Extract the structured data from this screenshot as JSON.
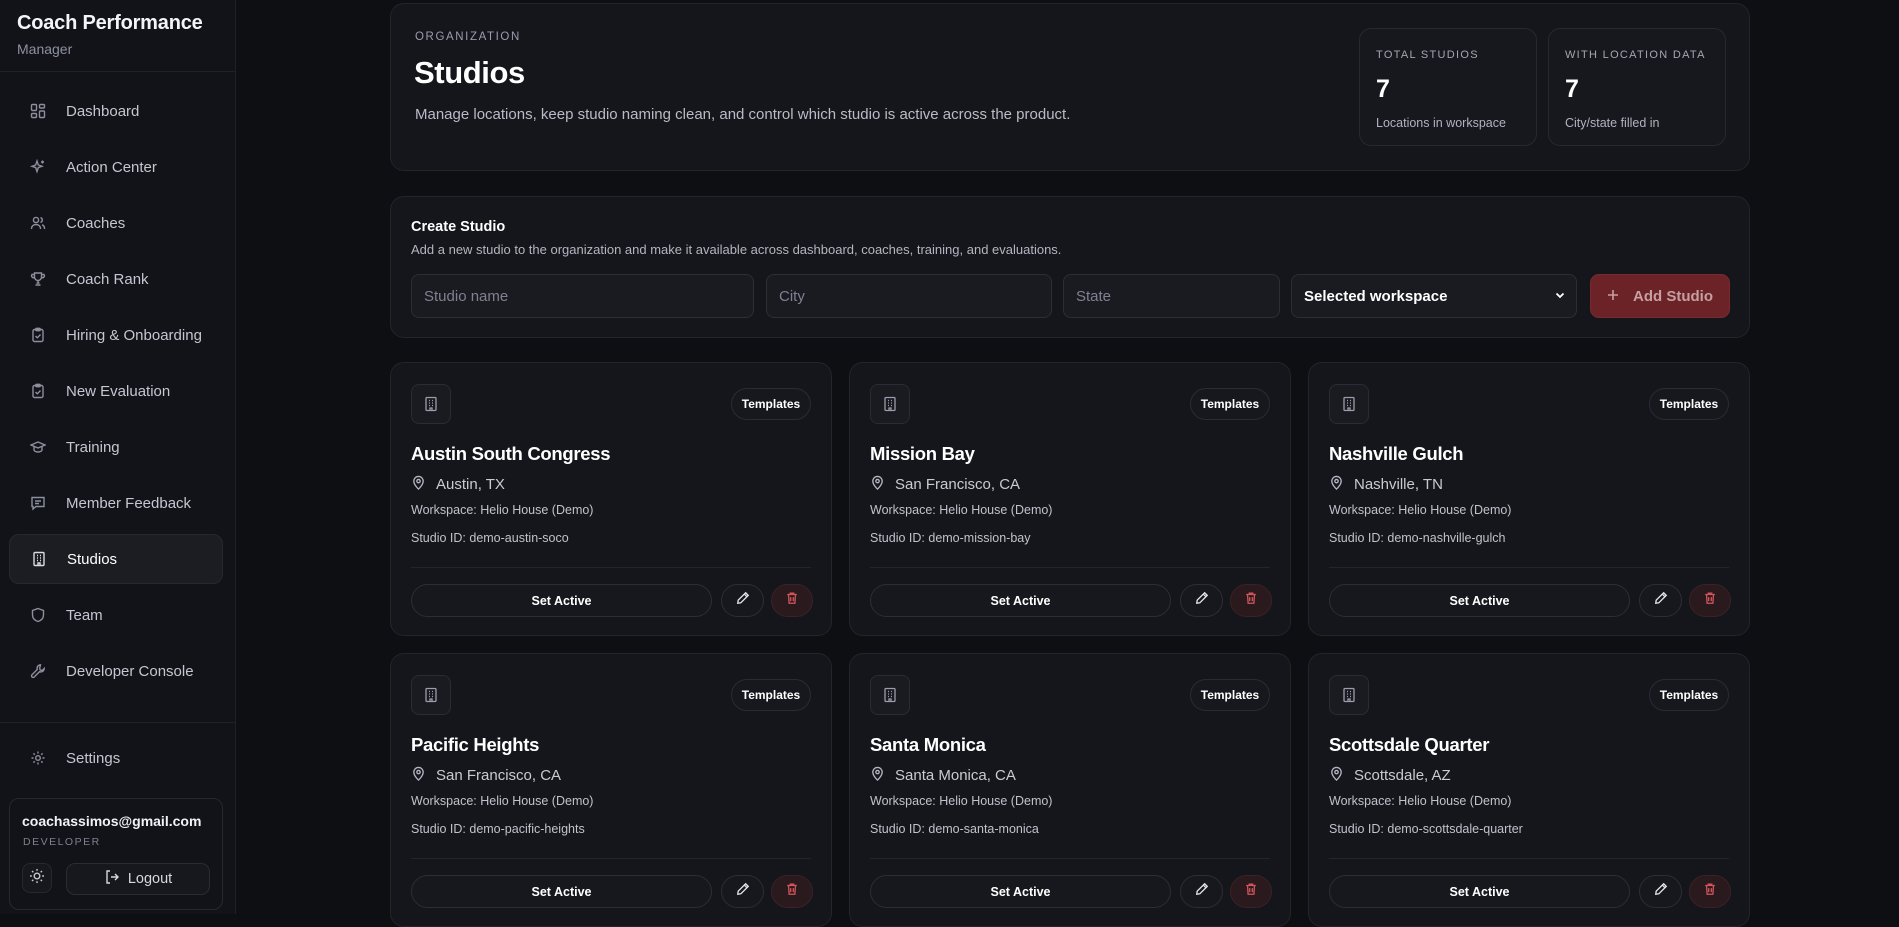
{
  "app": {
    "title": "Coach Performance",
    "subtitle": "Manager"
  },
  "nav": [
    {
      "label": "Dashboard",
      "icon": "dashboard-icon"
    },
    {
      "label": "Action Center",
      "icon": "sparkle-icon"
    },
    {
      "label": "Coaches",
      "icon": "users-icon"
    },
    {
      "label": "Coach Rank",
      "icon": "trophy-icon"
    },
    {
      "label": "Hiring & Onboarding",
      "icon": "clipboard-icon"
    },
    {
      "label": "New Evaluation",
      "icon": "clipboard-check-icon"
    },
    {
      "label": "Training",
      "icon": "graduation-cap-icon"
    },
    {
      "label": "Member Feedback",
      "icon": "message-icon"
    },
    {
      "label": "Studios",
      "icon": "building-icon",
      "active": true
    },
    {
      "label": "Team",
      "icon": "shield-icon"
    },
    {
      "label": "Developer Console",
      "icon": "wrench-icon"
    }
  ],
  "settings_label": "Settings",
  "user": {
    "email": "coachassimos@gmail.com",
    "role": "DEVELOPER",
    "logout_label": "Logout"
  },
  "header": {
    "eyebrow": "ORGANIZATION",
    "title": "Studios",
    "description": "Manage locations, keep studio naming clean, and control which studio is active across the product.",
    "stats": [
      {
        "label": "TOTAL STUDIOS",
        "value": "7",
        "sub": "Locations in workspace"
      },
      {
        "label": "WITH LOCATION DATA",
        "value": "7",
        "sub": "City/state filled in"
      }
    ]
  },
  "create": {
    "title": "Create Studio",
    "description": "Add a new studio to the organization and make it available across dashboard, coaches, training, and evaluations.",
    "name_placeholder": "Studio name",
    "city_placeholder": "City",
    "state_placeholder": "State",
    "workspace_selected": "Selected workspace",
    "add_label": "Add Studio"
  },
  "card_labels": {
    "templates": "Templates",
    "set_active": "Set Active"
  },
  "studios": [
    {
      "name": "Austin South Congress",
      "location": "Austin, TX",
      "workspace": "Workspace: Helio House (Demo)",
      "studio_id": "Studio ID: demo-austin-soco"
    },
    {
      "name": "Mission Bay",
      "location": "San Francisco, CA",
      "workspace": "Workspace: Helio House (Demo)",
      "studio_id": "Studio ID: demo-mission-bay"
    },
    {
      "name": "Nashville Gulch",
      "location": "Nashville, TN",
      "workspace": "Workspace: Helio House (Demo)",
      "studio_id": "Studio ID: demo-nashville-gulch"
    },
    {
      "name": "Pacific Heights",
      "location": "San Francisco, CA",
      "workspace": "Workspace: Helio House (Demo)",
      "studio_id": "Studio ID: demo-pacific-heights"
    },
    {
      "name": "Santa Monica",
      "location": "Santa Monica, CA",
      "workspace": "Workspace: Helio House (Demo)",
      "studio_id": "Studio ID: demo-santa-monica"
    },
    {
      "name": "Scottsdale Quarter",
      "location": "Scottsdale, AZ",
      "workspace": "Workspace: Helio House (Demo)",
      "studio_id": "Studio ID: demo-scottsdale-quarter"
    }
  ],
  "colors": {
    "background": "#0e0f13",
    "panel": "#15161b",
    "accent_red": "#6b2327",
    "danger_icon": "#d2555d"
  }
}
